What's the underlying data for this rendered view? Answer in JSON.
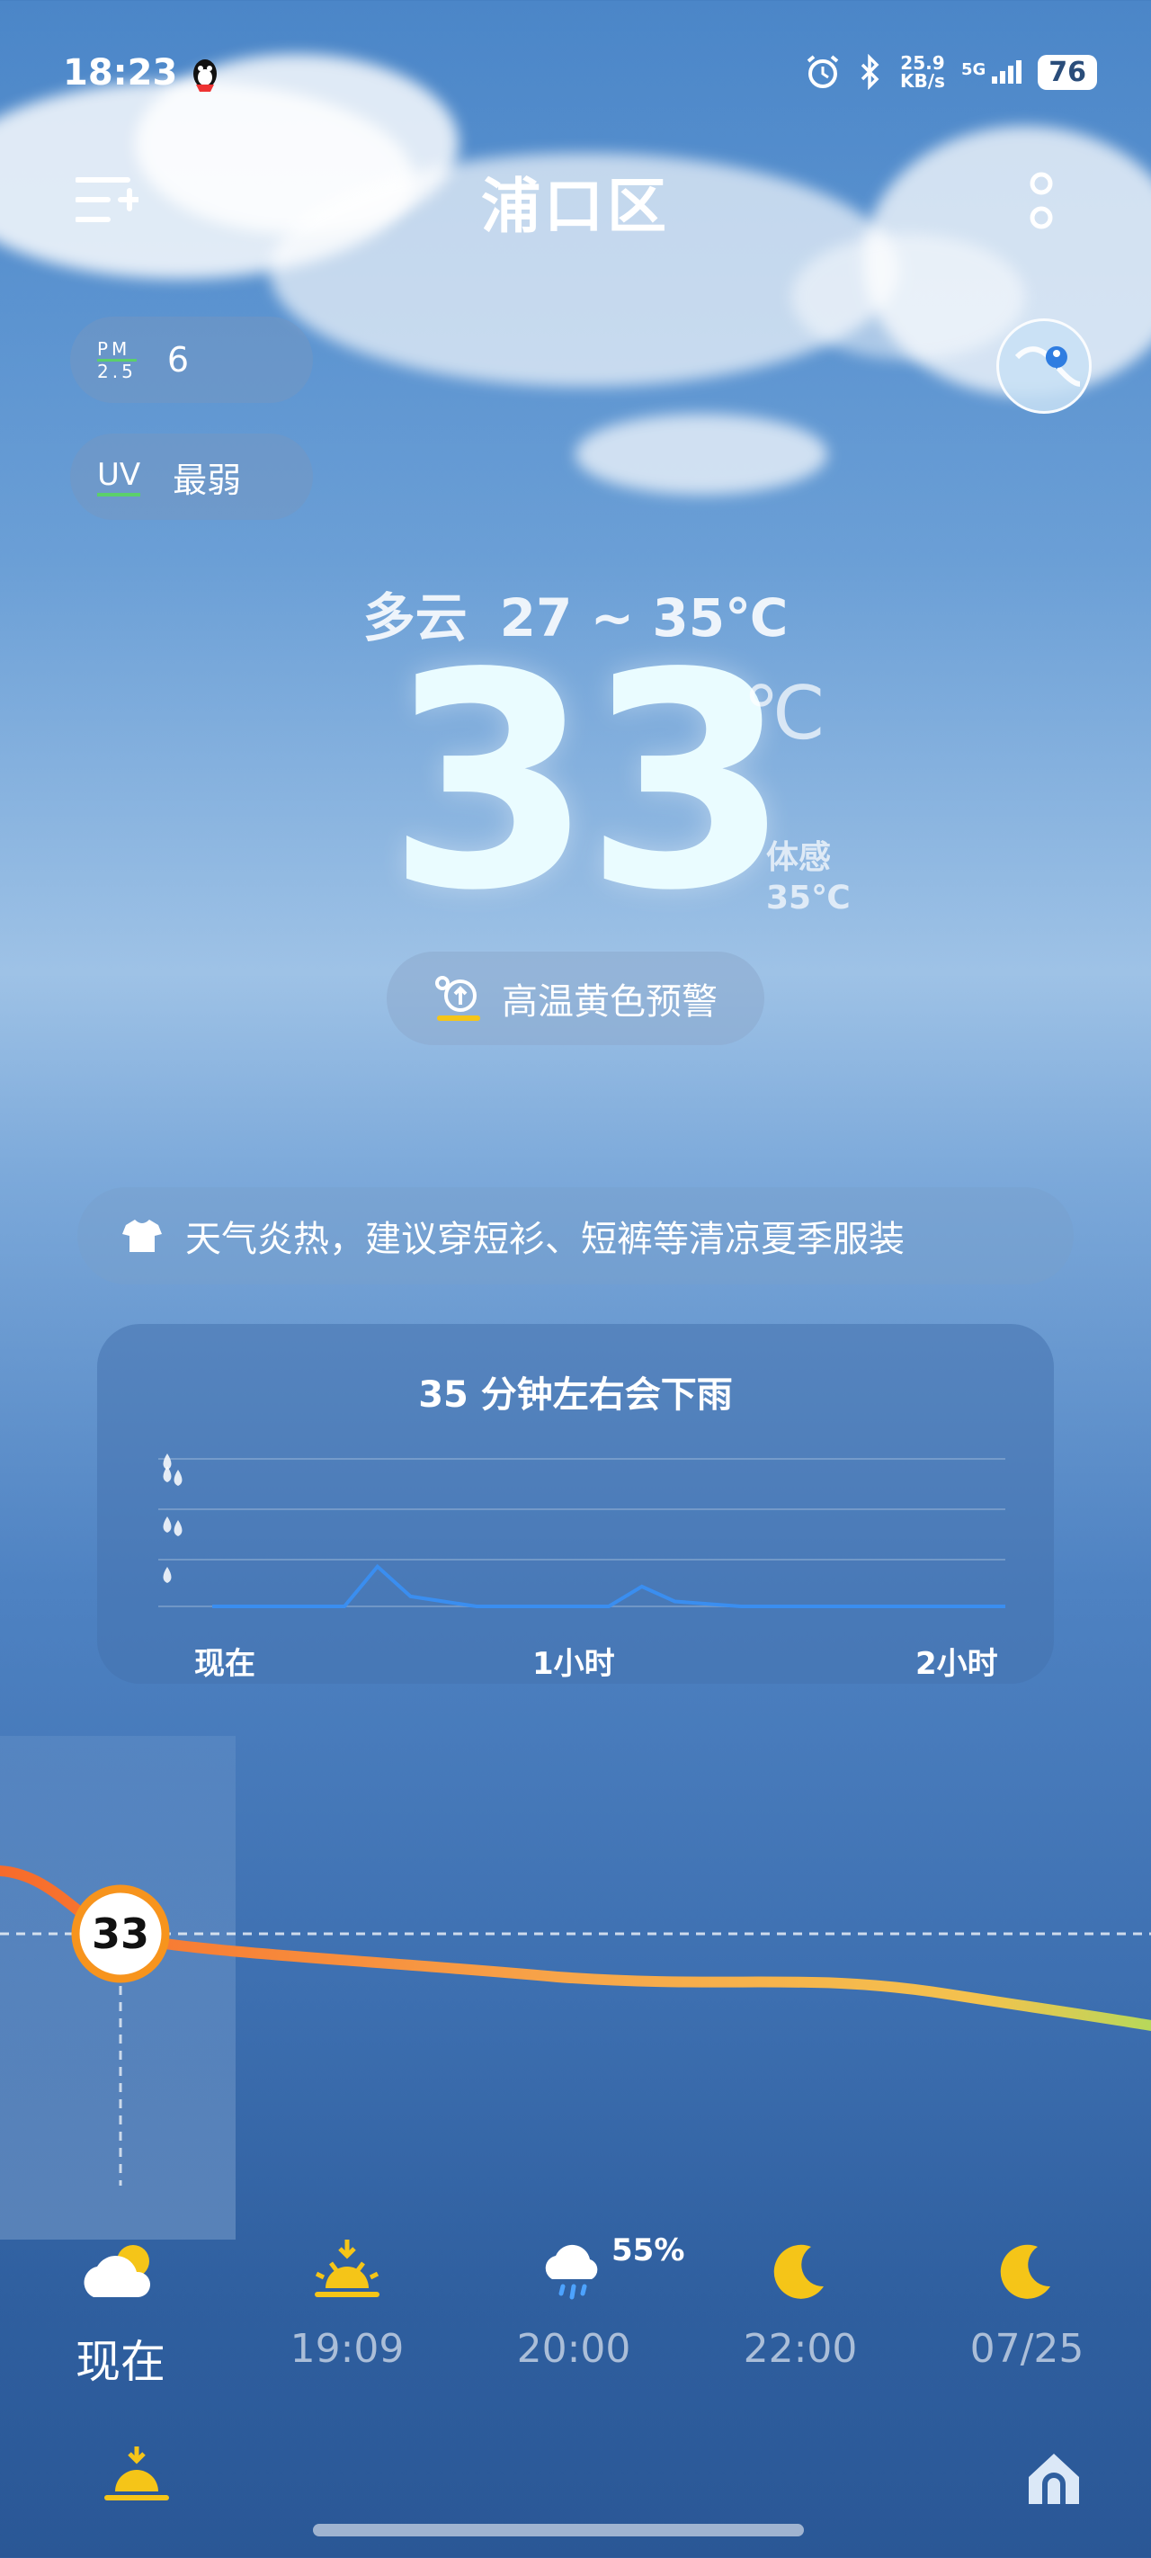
{
  "status_bar": {
    "time": "18:23",
    "net_speed_value": "25.9",
    "net_speed_unit": "KB/s",
    "network": "5G",
    "battery": "76"
  },
  "header": {
    "city": "浦口区"
  },
  "air": {
    "pm_label_top": "PM",
    "pm_label_bottom": "2.5",
    "pm_value": "6",
    "uv_label": "UV",
    "uv_value": "最弱"
  },
  "today": {
    "condition": "多云",
    "range": "27 ~ 35℃",
    "temp": "33",
    "unit": "℃",
    "feels_label": "体感",
    "feels_value": "35℃"
  },
  "warning": {
    "text": "高温黄色预警"
  },
  "advice": {
    "text": "天气炎热，建议穿短衫、短裤等清凉夏季服装"
  },
  "rain_forecast": {
    "title": "35 分钟左右会下雨",
    "axis": [
      "现在",
      "1小时",
      "2小时"
    ],
    "chart_data": {
      "type": "line",
      "x": [
        0,
        10,
        20,
        25,
        30,
        35,
        40,
        55,
        60,
        65,
        70,
        80,
        90,
        100,
        120
      ],
      "values": [
        0,
        0,
        0,
        0.8,
        0.2,
        0.1,
        0,
        0,
        0,
        0.4,
        0.1,
        0,
        0,
        0,
        0
      ],
      "xlabel": "",
      "ylabel": "",
      "grid": true
    }
  },
  "hourly": {
    "current_temp": "33",
    "rain_probability": "55%",
    "items": [
      {
        "time": "现在",
        "icon": "partly-cloudy-icon"
      },
      {
        "time": "19:09",
        "icon": "sunset-icon"
      },
      {
        "time": "20:00",
        "icon": "rain-cloud-icon"
      },
      {
        "time": "22:00",
        "icon": "moon-icon"
      },
      {
        "time": "07/25",
        "icon": "moon-icon"
      }
    ]
  },
  "colors": {
    "accent": "#f7941d",
    "rain_line": "#3a8ef0",
    "sun": "#f5c518"
  }
}
